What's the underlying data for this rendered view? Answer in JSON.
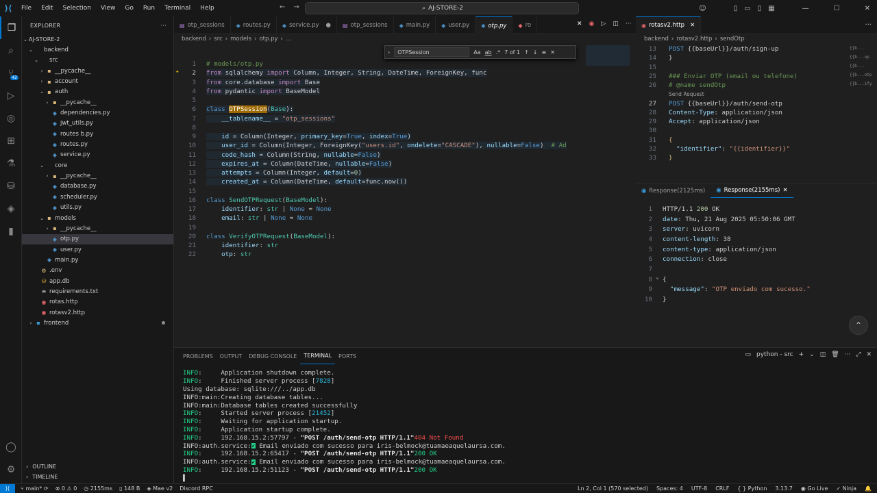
{
  "titlebar": {
    "menu": [
      "File",
      "Edit",
      "Selection",
      "View",
      "Go",
      "Run",
      "Terminal",
      "Help"
    ],
    "search": "AJ-STORE-2"
  },
  "activity_badge": "42",
  "explorer": {
    "title": "EXPLORER",
    "root": "AJ-STORE-2",
    "rows": [
      {
        "label": "backend",
        "depth": 1,
        "kind": "folder-open"
      },
      {
        "label": "src",
        "depth": 2,
        "kind": "folder-open"
      },
      {
        "label": "__pycache__",
        "depth": 3,
        "kind": "folder"
      },
      {
        "label": "account",
        "depth": 3,
        "kind": "folder"
      },
      {
        "label": "auth",
        "depth": 3,
        "kind": "folder-open"
      },
      {
        "label": "__pycache__",
        "depth": 4,
        "kind": "folder"
      },
      {
        "label": "dependencies.py",
        "depth": 4,
        "kind": "py"
      },
      {
        "label": "jwt_utils.py",
        "depth": 4,
        "kind": "py"
      },
      {
        "label": "routes b.py",
        "depth": 4,
        "kind": "py"
      },
      {
        "label": "routes.py",
        "depth": 4,
        "kind": "py"
      },
      {
        "label": "service.py",
        "depth": 4,
        "kind": "py"
      },
      {
        "label": "core",
        "depth": 3,
        "kind": "folder-open"
      },
      {
        "label": "__pycache__",
        "depth": 4,
        "kind": "folder"
      },
      {
        "label": "database.py",
        "depth": 4,
        "kind": "py"
      },
      {
        "label": "scheduler.py",
        "depth": 4,
        "kind": "py"
      },
      {
        "label": "utils.py",
        "depth": 4,
        "kind": "py"
      },
      {
        "label": "models",
        "depth": 3,
        "kind": "folder-open"
      },
      {
        "label": "__pycache__",
        "depth": 4,
        "kind": "folder"
      },
      {
        "label": "otp.py",
        "depth": 4,
        "kind": "py",
        "selected": true
      },
      {
        "label": "user.py",
        "depth": 4,
        "kind": "py"
      },
      {
        "label": "main.py",
        "depth": 3,
        "kind": "py"
      },
      {
        "label": ".env",
        "depth": 2,
        "kind": "env"
      },
      {
        "label": "app.db",
        "depth": 2,
        "kind": "db"
      },
      {
        "label": "requirements.txt",
        "depth": 2,
        "kind": "txt"
      },
      {
        "label": "rotas.http",
        "depth": 2,
        "kind": "http"
      },
      {
        "label": "rotasv2.http",
        "depth": 2,
        "kind": "http"
      },
      {
        "label": "frontend",
        "depth": 1,
        "kind": "fe",
        "dot": true
      }
    ],
    "outline": "OUTLINE",
    "timeline": "TIMELINE"
  },
  "editor": {
    "tabs": [
      {
        "label": "otp_sessions",
        "kind": "sess"
      },
      {
        "label": "routes.py",
        "kind": "py"
      },
      {
        "label": "service.py",
        "kind": "py",
        "dirty": true
      },
      {
        "label": "otp_sessions",
        "kind": "sess"
      },
      {
        "label": "main.py",
        "kind": "py"
      },
      {
        "label": "user.py",
        "kind": "py"
      },
      {
        "label": "otp.py",
        "kind": "py",
        "active": true
      },
      {
        "label": "ro",
        "kind": "http"
      }
    ],
    "breadcrumb": [
      "backend",
      "src",
      "models",
      "otp.py",
      "..."
    ],
    "find": {
      "query": "OTPSession",
      "aa": "Aa",
      "ab": "ab",
      "re": ".*",
      "count": "7 of 1"
    },
    "lines": [
      {
        "n": "1",
        "html": "<span class=\"cm\"># models/otp.py</span>"
      },
      {
        "n": "2",
        "html": "<span class=\"kw2\">from</span> sqlalchemy <span class=\"kw2\">import</span> Column, Integer, String, DateTime, ForeignKey, func",
        "hl": true
      },
      {
        "n": "3",
        "html": "<span class=\"kw2\">from</span> core.database <span class=\"kw2\">import</span> Base",
        "hl": true
      },
      {
        "n": "4",
        "html": "<span class=\"kw2\">from</span> pydantic <span class=\"kw2\">import</span> BaseModel",
        "hl": true
      },
      {
        "n": "5",
        "html": ""
      },
      {
        "n": "6",
        "html": "<span class=\"kw\">class</span> <span class=\"cls match\">OTPSession</span>(<span class=\"cls\">Base</span>):",
        "hl": true
      },
      {
        "n": "7",
        "html": "    <span class=\"var\">__tablename__</span> = <span class=\"str\">\"otp_sessions\"</span>",
        "hl": true
      },
      {
        "n": "8",
        "html": ""
      },
      {
        "n": "9",
        "html": "    <span class=\"var\">id</span> = Column(Integer, <span class=\"var\">primary_key</span>=<span class=\"cnst\">True</span>, <span class=\"var\">index</span>=<span class=\"cnst\">True</span>)",
        "hl": true
      },
      {
        "n": "10",
        "html": "    <span class=\"var\">user_id</span> = Column(Integer, ForeignKey(<span class=\"str\">\"users.id\"</span>, <span class=\"var\">ondelete</span>=<span class=\"str\">\"CASCADE\"</span>), <span class=\"var\">nullable</span>=<span class=\"cnst\">False</span>)  <span class=\"cm\"># Ad</span>",
        "hl": true
      },
      {
        "n": "11",
        "html": "    <span class=\"var\">code_hash</span> = Column(String, <span class=\"var\">nullable</span>=<span class=\"cnst\">False</span>)",
        "hl": true
      },
      {
        "n": "12",
        "html": "    <span class=\"var\">expires_at</span> = Column(DateTime, <span class=\"var\">nullable</span>=<span class=\"cnst\">False</span>)",
        "hl": true
      },
      {
        "n": "13",
        "html": "    <span class=\"var\">attempts</span> = Column(Integer, <span class=\"var\">default</span>=<span class=\"num\">0</span>)",
        "hl": true
      },
      {
        "n": "14",
        "html": "    <span class=\"var\">created_at</span> = Column(DateTime, <span class=\"var\">default</span>=func.now())",
        "hl": true
      },
      {
        "n": "15",
        "html": ""
      },
      {
        "n": "16",
        "html": "<span class=\"kw\">class</span> <span class=\"cls\">SendOTPRequest</span>(<span class=\"cls\">BaseModel</span>):"
      },
      {
        "n": "17",
        "html": "    <span class=\"var\">identifier</span>: <span class=\"cls\">str</span> | <span class=\"cnst\">None</span> = <span class=\"cnst\">None</span>"
      },
      {
        "n": "18",
        "html": "    <span class=\"var\">email</span>: <span class=\"cls\">str</span> | <span class=\"cnst\">None</span> = <span class=\"cnst\">None</span>"
      },
      {
        "n": "19",
        "html": ""
      },
      {
        "n": "20",
        "html": "<span class=\"kw\">class</span> <span class=\"cls\">VerifyOTPRequest</span>(<span class=\"cls\">BaseModel</span>):"
      },
      {
        "n": "21",
        "html": "    <span class=\"var\">identifier</span>: <span class=\"cls\">str</span>"
      },
      {
        "n": "22",
        "html": "    <span class=\"var\">otp</span>: <span class=\"cls\">str</span>"
      }
    ]
  },
  "right": {
    "tab": "rotasv2.http",
    "breadcrumb": [
      "backend",
      "rotasv2.http",
      "sendOtp"
    ],
    "lines": [
      {
        "n": "13",
        "html": "<span class=\"kw\">POST</span> {{baseUrl}}/auth/sign-up"
      },
      {
        "n": "14",
        "html": "}"
      },
      {
        "n": "15",
        "html": ""
      },
      {
        "n": "25",
        "html": "<span class=\"cm\">### Enviar OTP (email ou telefone)</span>"
      },
      {
        "n": "26",
        "html": "<span class=\"cm\"># @name sendOtp</span>"
      },
      {
        "n": "",
        "html": "<span style=\"font-family:'DejaVu Sans',sans-serif;font-size:7.5px;color:#a0a0a0\">Send Request</span>",
        "codelens": true
      },
      {
        "n": "27",
        "html": "<span class=\"kw\">POST</span> {{baseUrl}}/auth/send-otp"
      },
      {
        "n": "28",
        "html": "<span class=\"hdrn\">Content-Type</span>: application/json"
      },
      {
        "n": "29",
        "html": "<span class=\"hdrn\">Accept</span>: application/json"
      },
      {
        "n": "30",
        "html": ""
      },
      {
        "n": "31",
        "html": "<span class=\"hp\">{</span>"
      },
      {
        "n": "32",
        "html": "  <span class=\"hdrn\">\"identifier\"</span>: <span class=\"str\">\"{{identifier}}\"</span>"
      },
      {
        "n": "33",
        "html": "<span class=\"hp\">}</span>"
      }
    ],
    "minimap": [
      "{{b...",
      "{{b...up",
      "{{b...",
      "{{b...otp",
      "{{b...ify"
    ],
    "resp_tabs": [
      "Response(2125ms)",
      "Response(2155ms)"
    ],
    "resp_lines": [
      {
        "n": "1",
        "html": "HTTP/1.1 <span class=\"num\">200</span> OK"
      },
      {
        "n": "2",
        "html": "<span class=\"hdrn\">date</span>: Thu, 21 Aug 2025 05:50:06 GMT"
      },
      {
        "n": "3",
        "html": "<span class=\"hdrn\">server</span>: uvicorn"
      },
      {
        "n": "4",
        "html": "<span class=\"hdrn\">content-length</span>: 38"
      },
      {
        "n": "5",
        "html": "<span class=\"hdrn\">content-type</span>: application/json"
      },
      {
        "n": "6",
        "html": "<span class=\"hdrn\">connection</span>: close"
      },
      {
        "n": "7",
        "html": ""
      },
      {
        "n": "8",
        "html": "{"
      },
      {
        "n": "9",
        "html": "  <span class=\"hdrn\">\"message\"</span>: <span class=\"str\">\"OTP enviado com sucesso.\"</span>"
      },
      {
        "n": "10",
        "html": "}"
      }
    ]
  },
  "panel": {
    "tabs": [
      "PROBLEMS",
      "OUTPUT",
      "DEBUG CONSOLE",
      "TERMINAL",
      "PORTS"
    ],
    "active_tab": "TERMINAL",
    "shell": "python - src",
    "terminal": [
      "<span class=\"ok\">INFO</span>:     Application shutdown complete.",
      "<span class=\"ok\">INFO</span>:     Finished server process [<span class=\"cy\">7828</span>]",
      "Using database: sqlite:///../app.db",
      "INFO:main:Creating database tables...",
      "INFO:main:Database tables created successfully",
      "<span class=\"ok\">INFO</span>:     Started server process [<span class=\"cy\">21452</span>]",
      "<span class=\"ok\">INFO</span>:     Waiting for application startup.",
      "<span class=\"ok\">INFO</span>:     Application startup complete.",
      "<span class=\"ok\">INFO</span>:     192.168.15.2:57797 - <span class=\"bold\">\"POST /auth/send-otp HTTP/1.1\"</span> <span style=\"color:#f14c4c\">404 Not Found</span>",
      "INFO:auth.service:<span class=\"green-chk\">✔</span> Email enviado com sucesso para iris-belmock@tuamaeaquelaursa.com.",
      "<span class=\"ok\">INFO</span>:     192.168.15.2:65417 - <span class=\"bold\">\"POST /auth/send-otp HTTP/1.1\"</span> <span class=\"ok\">200 OK</span>",
      "INFO:auth.service:<span class=\"green-chk\">✔</span> Email enviado com sucesso para iris-belmock@tuamaeaquelaursa.com.",
      "<span class=\"ok\">INFO</span>:     192.168.15.2:51123 - <span class=\"bold\">\"POST /auth/send-otp HTTP/1.1\"</span> <span class=\"ok\">200 OK</span>",
      "▌"
    ]
  },
  "status": {
    "branch": "main*",
    "errors": "⊗ 0  ⚠ 0",
    "time": "2155ms",
    "size": "148 B",
    "mae": "Mae v2",
    "discord": "Discord RPC",
    "cursor": "Ln 2, Col 1 (570 selected)",
    "spaces": "Spaces: 4",
    "encoding": "UTF-8",
    "eol": "CRLF",
    "lang": "Python",
    "version": "3.13.7",
    "golive": "Go Live",
    "ninja": "Ninja"
  },
  "colors": {
    "accent": "#0078d4",
    "match": "#9e6a03"
  }
}
